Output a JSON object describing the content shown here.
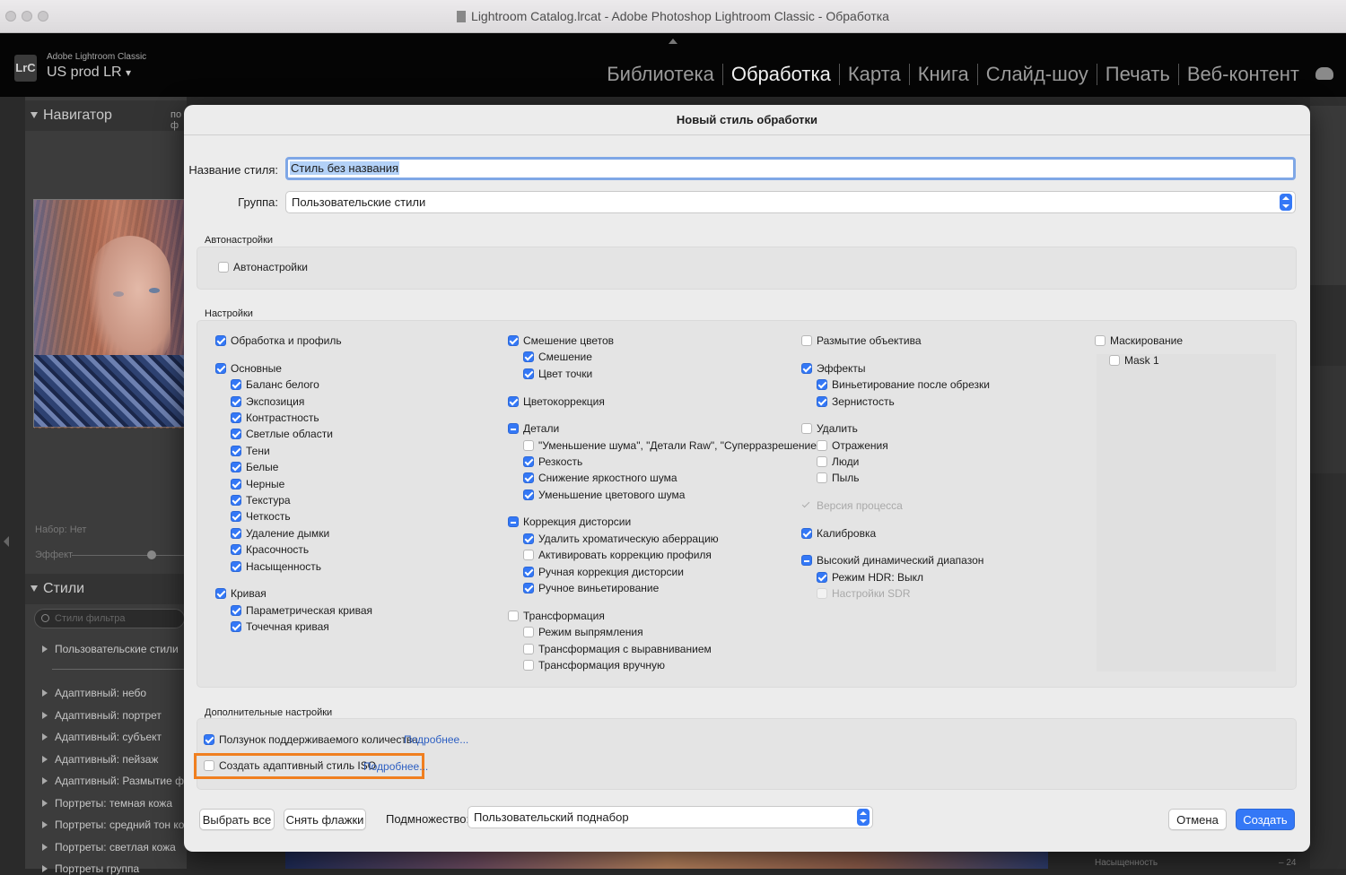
{
  "window": {
    "title": "Lightroom Catalog.lrcat - Adobe Photoshop Lightroom Classic - Обработка"
  },
  "lr": {
    "logo": "LrC",
    "app_name": "Adobe Lightroom Classic",
    "catalog_name": "US prod LR",
    "modules": [
      "Библиотека",
      "Обработка",
      "Карта",
      "Книга",
      "Слайд-шоу",
      "Печать",
      "Веб-контент"
    ],
    "active_module": "Обработка"
  },
  "left_panel": {
    "navigator_label": "Навигатор",
    "navigator_extra": "по ф",
    "preset_set_label": "Набор: Нет",
    "effect_label": "Эффект",
    "styles_label": "Стили",
    "search_placeholder": "Стили фильтра",
    "style_groups": [
      "Пользовательские стили",
      "Адаптивный: небо",
      "Адаптивный: портрет",
      "Адаптивный: субъект",
      "Адаптивный: пейзаж",
      "Адаптивный: Размытие фона",
      "Портреты: темная кожа",
      "Портреты: средний тон кожи",
      "Портреты: светлая кожа",
      "Портреты группа"
    ]
  },
  "right_panel": {
    "saturation_label": "Насыщенность",
    "saturation_value": "– 24"
  },
  "dialog": {
    "title": "Новый стиль обработки",
    "name_label": "Название стиля:",
    "name_value": "Стиль без названия",
    "group_label": "Группа:",
    "group_value": "Пользовательские стили",
    "auto_section_title": "Автонастройки",
    "auto_checkbox": {
      "label": "Автонастройки",
      "checked": false
    },
    "settings_section_title": "Настройки",
    "col1": [
      {
        "label": "Обработка и профиль",
        "state": "on",
        "indent": 0
      },
      {
        "label": "Основные",
        "state": "on",
        "indent": 0
      },
      {
        "label": "Баланс белого",
        "state": "on",
        "indent": 1
      },
      {
        "label": "Экспозиция",
        "state": "on",
        "indent": 1
      },
      {
        "label": "Контрастность",
        "state": "on",
        "indent": 1
      },
      {
        "label": "Светлые области",
        "state": "on",
        "indent": 1
      },
      {
        "label": "Тени",
        "state": "on",
        "indent": 1
      },
      {
        "label": "Белые",
        "state": "on",
        "indent": 1
      },
      {
        "label": "Черные",
        "state": "on",
        "indent": 1
      },
      {
        "label": "Текстура",
        "state": "on",
        "indent": 1
      },
      {
        "label": "Четкость",
        "state": "on",
        "indent": 1
      },
      {
        "label": "Удаление дымки",
        "state": "on",
        "indent": 1
      },
      {
        "label": "Красочность",
        "state": "on",
        "indent": 1
      },
      {
        "label": "Насыщенность",
        "state": "on",
        "indent": 1
      },
      {
        "label": "Кривая",
        "state": "on",
        "indent": 0
      },
      {
        "label": "Параметрическая кривая",
        "state": "on",
        "indent": 1
      },
      {
        "label": "Точечная кривая",
        "state": "on",
        "indent": 1
      }
    ],
    "col2": [
      {
        "label": "Смешение цветов",
        "state": "on",
        "indent": 0
      },
      {
        "label": "Смешение",
        "state": "on",
        "indent": 1
      },
      {
        "label": "Цвет точки",
        "state": "on",
        "indent": 1
      },
      {
        "label": "Цветокоррекция",
        "state": "on",
        "indent": 0
      },
      {
        "label": "Детали",
        "state": "mixed",
        "indent": 0
      },
      {
        "label": "\"Уменьшение шума\", \"Детали Raw\", \"Суперразрешение\"",
        "state": "off",
        "indent": 1
      },
      {
        "label": "Резкость",
        "state": "on",
        "indent": 1
      },
      {
        "label": "Снижение яркостного шума",
        "state": "on",
        "indent": 1
      },
      {
        "label": "Уменьшение цветового шума",
        "state": "on",
        "indent": 1
      },
      {
        "label": "Коррекция дисторсии",
        "state": "mixed",
        "indent": 0
      },
      {
        "label": "Удалить хроматическую аберрацию",
        "state": "on",
        "indent": 1
      },
      {
        "label": "Активировать коррекцию профиля",
        "state": "off",
        "indent": 1
      },
      {
        "label": "Ручная коррекция дисторсии",
        "state": "on",
        "indent": 1
      },
      {
        "label": "Ручное виньетирование",
        "state": "on",
        "indent": 1
      },
      {
        "label": "Трансформация",
        "state": "off",
        "indent": 0
      },
      {
        "label": "Режим выпрямления",
        "state": "off",
        "indent": 1
      },
      {
        "label": "Трансформация с выравниванием",
        "state": "off",
        "indent": 1
      },
      {
        "label": "Трансформация вручную",
        "state": "off",
        "indent": 1
      }
    ],
    "col3": [
      {
        "label": "Размытие объектива",
        "state": "off",
        "indent": 0
      },
      {
        "label": "Эффекты",
        "state": "on",
        "indent": 0
      },
      {
        "label": "Виньетирование после обрезки",
        "state": "on",
        "indent": 1
      },
      {
        "label": "Зернистость",
        "state": "on",
        "indent": 1
      },
      {
        "label": "Удалить",
        "state": "off",
        "indent": 0
      },
      {
        "label": "Отражения",
        "state": "off",
        "indent": 1
      },
      {
        "label": "Люди",
        "state": "off",
        "indent": 1
      },
      {
        "label": "Пыль",
        "state": "off",
        "indent": 1
      },
      {
        "label": "Версия процесса",
        "state": "disabled-on",
        "indent": 0
      },
      {
        "label": "Калибровка",
        "state": "on",
        "indent": 0
      },
      {
        "label": "Высокий динамический диапазон",
        "state": "mixed",
        "indent": 0
      },
      {
        "label": "Режим HDR: Выкл",
        "state": "on",
        "indent": 1
      },
      {
        "label": "Настройки SDR",
        "state": "disabled",
        "indent": 1
      }
    ],
    "col4": [
      {
        "label": "Маскирование",
        "state": "off",
        "indent": 0
      },
      {
        "label": "Mask 1",
        "state": "off",
        "indent": 1
      }
    ],
    "extra_section_title": "Дополнительные настройки",
    "extra": [
      {
        "label": "Ползунок поддерживаемого количества",
        "checked": true,
        "link": "Подробнее..."
      },
      {
        "label": "Создать адаптивный стиль ISO",
        "checked": false,
        "link": "Подробнее..."
      }
    ],
    "select_all_label": "Выбрать все",
    "deselect_label": "Снять флажки",
    "subset_label": "Подмножество:",
    "subset_value": "Пользовательский поднабор",
    "cancel_label": "Отмена",
    "create_label": "Создать"
  },
  "colors": {
    "accent": "#3478f6",
    "highlight_outline": "#f07f1f",
    "link": "#2d5fc2"
  }
}
